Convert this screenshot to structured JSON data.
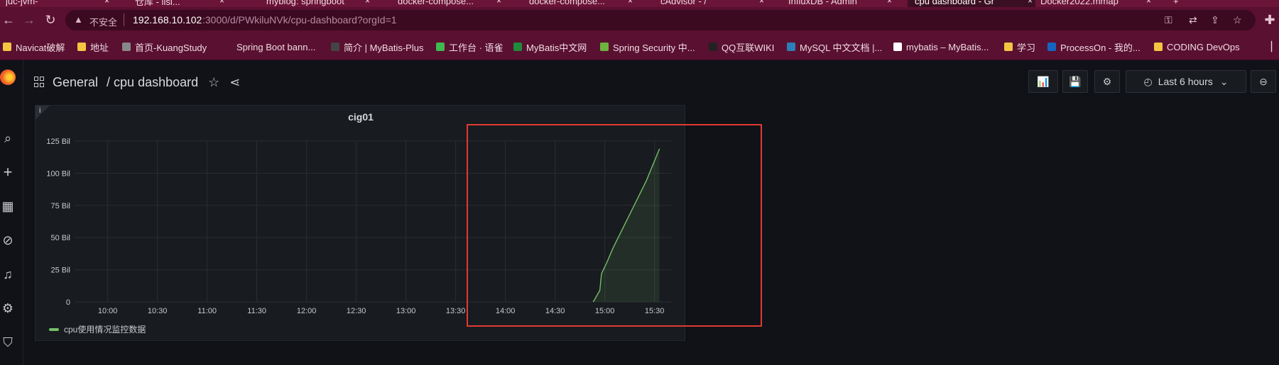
{
  "browser": {
    "tabs": [
      {
        "label": "juc-jvm-"
      },
      {
        "label": "仓库 - lisi..."
      },
      {
        "label": "myblog: springboot"
      },
      {
        "label": "docker-compose..."
      },
      {
        "label": "docker-compose..."
      },
      {
        "label": "cAdvisor - /"
      },
      {
        "label": "InfluxDB - Admin"
      },
      {
        "label": "cpu dashboard - Gr"
      },
      {
        "label": "Docker2022.mmap"
      }
    ],
    "address": {
      "insecure_label": "不安全",
      "host": "192.168.10.102",
      "path": ":3000/d/PWkiluNVk/cpu-dashboard?orgId=1"
    },
    "bookmarks": [
      {
        "label": "Navicat破解",
        "color": "#f4c542"
      },
      {
        "label": "地址",
        "color": "#f4c542"
      },
      {
        "label": "首页-KuangStudy",
        "color": "#888888"
      },
      {
        "label": "Spring Boot bann...",
        "color": "#5a1030"
      },
      {
        "label": "简介 | MyBatis-Plus",
        "color": "#444444"
      },
      {
        "label": "工作台 · 语雀",
        "color": "#3fb950"
      },
      {
        "label": "MyBatis中文网",
        "color": "#1f8a3a"
      },
      {
        "label": "Spring Security 中...",
        "color": "#6db33f"
      },
      {
        "label": "QQ互联WIKI",
        "color": "#222222"
      },
      {
        "label": "MySQL 中文文档 |...",
        "color": "#2c7fb8"
      },
      {
        "label": "mybatis – MyBatis...",
        "color": "#ffffff"
      },
      {
        "label": "学习",
        "color": "#f4c542"
      },
      {
        "label": "ProcessOn - 我的...",
        "color": "#1565c0"
      },
      {
        "label": "CODING DevOps",
        "color": "#f4c542"
      }
    ]
  },
  "dashboard": {
    "folder": "General",
    "title": "/ cpu dashboard",
    "time_range": "Last 6 hours"
  },
  "panel": {
    "title": "cig01",
    "info": "i",
    "legend": {
      "label": "cpu使用情况监控数据",
      "color": "#73bf69"
    }
  },
  "chart_data": {
    "type": "area",
    "title": "cig01",
    "xlabel": "",
    "ylabel": "",
    "x_ticks": [
      "10:00",
      "10:30",
      "11:00",
      "11:30",
      "12:00",
      "12:30",
      "13:00",
      "13:30",
      "14:00",
      "14:30",
      "15:00",
      "15:30"
    ],
    "y_ticks": [
      "0",
      "25 Bil",
      "50 Bil",
      "75 Bil",
      "100 Bil",
      "125 Bil"
    ],
    "ylim": [
      0,
      125
    ],
    "grid": true,
    "legend_position": "bottom-left",
    "series": [
      {
        "name": "cpu使用情况监控数据",
        "color": "#73bf69",
        "points": [
          {
            "t": "14:53",
            "y": 0
          },
          {
            "t": "14:57",
            "y": 9
          },
          {
            "t": "14:58",
            "y": 22
          },
          {
            "t": "15:01",
            "y": 30
          },
          {
            "t": "15:05",
            "y": 42
          },
          {
            "t": "15:15",
            "y": 68
          },
          {
            "t": "15:25",
            "y": 94
          },
          {
            "t": "15:33",
            "y": 119
          }
        ]
      }
    ]
  },
  "annotation": {
    "color": "#e03a33"
  }
}
